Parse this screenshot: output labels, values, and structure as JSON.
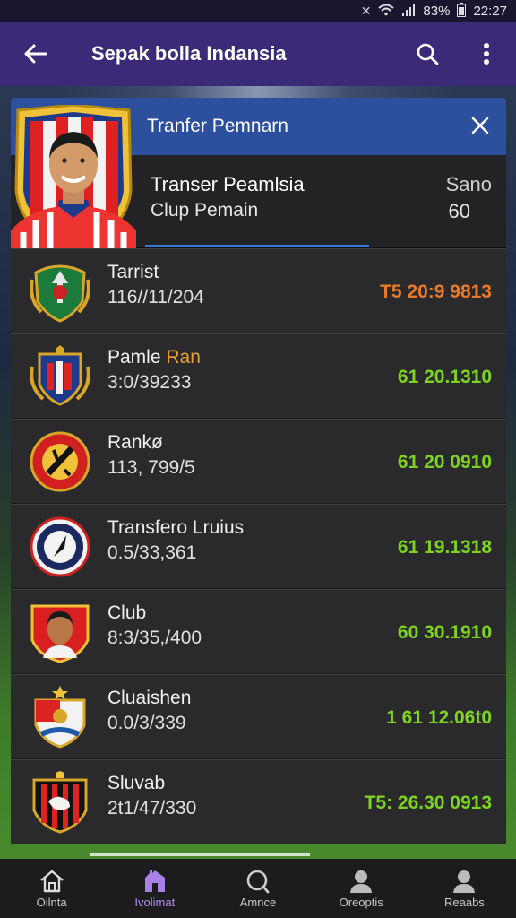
{
  "status_bar": {
    "battery": "83%",
    "time": "22:27"
  },
  "app_bar": {
    "title": "Sepak bolla Indansia"
  },
  "panel": {
    "title": "Tranfer Pemnarn",
    "hero": {
      "line1": "Transer Peamlsia",
      "line2": "Clup Pemain",
      "right1": "Sano",
      "right2": "60"
    }
  },
  "transfers": [
    {
      "name": "Tarrist",
      "date": "116//11/204",
      "amount": "T5 20:9 9813",
      "color": "#e87a2a"
    },
    {
      "name": "Pamle",
      "name_accent": "Ran",
      "date": "3:0/39233",
      "amount": "61 20.1310",
      "color": "#7ed321"
    },
    {
      "name": "Rankø",
      "date": "113, 799/5",
      "amount": "61 20 0910",
      "color": "#7ed321"
    },
    {
      "name": "Transfero Lruius",
      "date": "0.5/33,361",
      "amount": "61 19.1318",
      "color": "#7ed321"
    },
    {
      "name": "Club",
      "date": "8:3/35,/400",
      "amount": "60 30.1910",
      "color": "#7ed321"
    },
    {
      "name": "Cluaishen",
      "date": "0.0/3/339",
      "amount": "1 61 12.06t0",
      "color": "#7ed321"
    },
    {
      "name": "Sluvab",
      "date": "2t1/47/330",
      "amount": "T5: 26.30 0913",
      "color": "#7ed321"
    }
  ],
  "bottom_nav": [
    {
      "label": "Oilnta",
      "icon": "home-icon",
      "active": false
    },
    {
      "label": "Ivolimat",
      "icon": "building-icon",
      "active": true
    },
    {
      "label": "Amnce",
      "icon": "search-icon",
      "active": false
    },
    {
      "label": "Oreoptis",
      "icon": "person-icon",
      "active": false
    },
    {
      "label": "Reaabs",
      "icon": "profile-icon",
      "active": false
    }
  ],
  "colors": {
    "app_bar": "#3a2a78",
    "panel_header": "#2c4f9e",
    "nav_active": "#b48cf0",
    "amount_green": "#7ed321",
    "amount_orange": "#e87a2a"
  }
}
